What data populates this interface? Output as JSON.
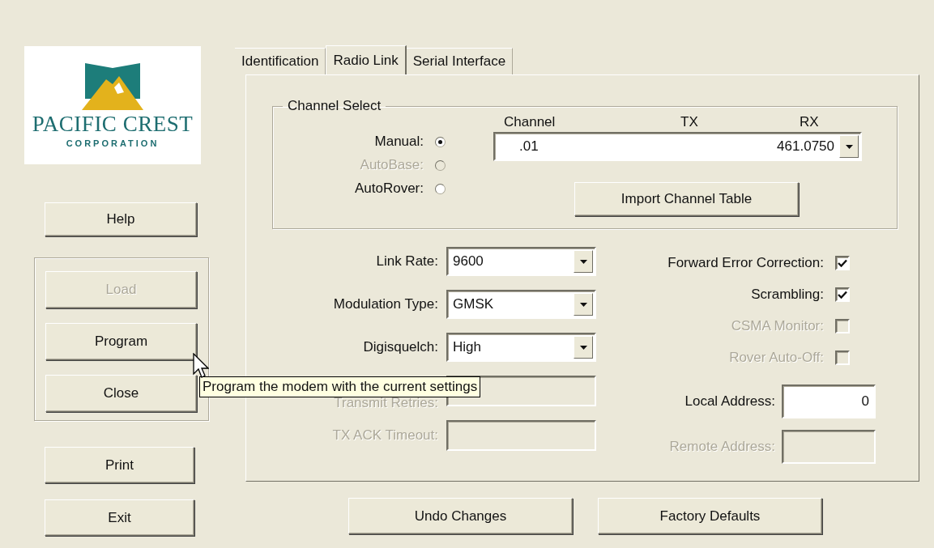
{
  "logo": {
    "name": "PACIFIC CREST",
    "subtitle": "CORPORATION"
  },
  "help_button": {
    "label": "Help",
    "disabled": false
  },
  "button_group": [
    {
      "label": "Load",
      "disabled": true
    },
    {
      "label": "Program",
      "disabled": false
    },
    {
      "label": "Close",
      "disabled": false
    }
  ],
  "lower_buttons": [
    {
      "label": "Print",
      "disabled": false
    },
    {
      "label": "Exit",
      "disabled": false
    }
  ],
  "tabs": [
    {
      "label": "Identification",
      "selected": false
    },
    {
      "label": "Radio Link",
      "selected": true
    },
    {
      "label": "Serial Interface",
      "selected": false
    }
  ],
  "channel_select": {
    "title": "Channel Select",
    "modes": [
      {
        "label": "Manual:",
        "selected": true,
        "disabled": false
      },
      {
        "label": "AutoBase:",
        "selected": false,
        "disabled": true
      },
      {
        "label": "AutoRover:",
        "selected": false,
        "disabled": false
      }
    ],
    "columns": [
      "Channel",
      "TX",
      "RX"
    ],
    "channel": ".01",
    "rx": "461.0750",
    "import_button": "Import Channel Table"
  },
  "settings": [
    {
      "label": "Link Rate:",
      "kind": "dropdown",
      "value": "9600",
      "disabled": false
    },
    {
      "label": "Modulation Type:",
      "kind": "dropdown",
      "value": "GMSK",
      "disabled": false
    },
    {
      "label": "Digisquelch:",
      "kind": "dropdown",
      "value": "High",
      "disabled": false
    },
    {
      "label": "Transmit Retries:",
      "kind": "text",
      "disabled": true
    },
    {
      "label": "TX ACK Timeout:",
      "kind": "text",
      "disabled": true
    }
  ],
  "options": [
    {
      "label": "Forward Error Correction:",
      "checked": true,
      "disabled": false
    },
    {
      "label": "Scrambling:",
      "checked": true,
      "disabled": false
    },
    {
      "label": "CSMA Monitor:",
      "checked": false,
      "disabled": true
    },
    {
      "label": "Rover Auto-Off:",
      "checked": false,
      "disabled": true
    }
  ],
  "addresses": [
    {
      "label": "Local Address:",
      "value": "0",
      "disabled": false
    },
    {
      "label": "Remote Address:",
      "disabled": true
    }
  ],
  "footer_buttons": [
    "Undo Changes",
    "Factory Defaults"
  ],
  "tooltip": {
    "text": "Program the modem with the current settings"
  }
}
